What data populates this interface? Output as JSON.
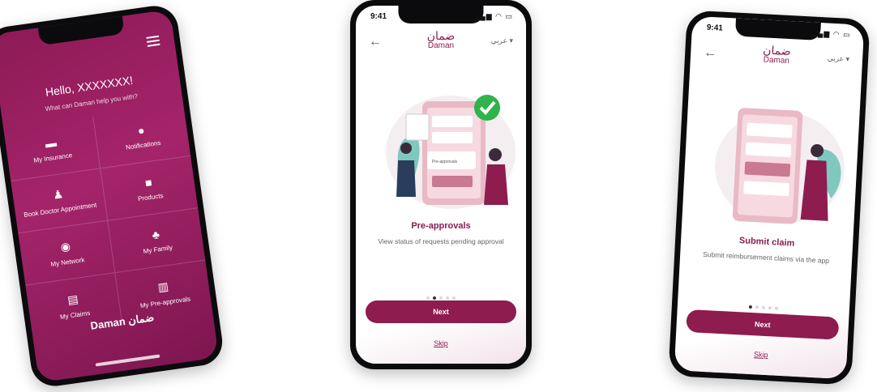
{
  "phone1": {
    "greeting": "Hello, XXXXXXX!",
    "subtitle": "What can Daman help you with?",
    "tiles": [
      {
        "label": "My Insurance",
        "icon": "insurance-card-icon"
      },
      {
        "label": "Notifications",
        "icon": "notification-bell-icon"
      },
      {
        "label": "Book Doctor Appointment",
        "icon": "doctor-icon"
      },
      {
        "label": "Products",
        "icon": "shopping-bag-icon"
      },
      {
        "label": "My Network",
        "icon": "network-globe-icon"
      },
      {
        "label": "My Family",
        "icon": "family-icon"
      },
      {
        "label": "My Claims",
        "icon": "document-icon"
      },
      {
        "label": "My Pre-approvals",
        "icon": "pre-approval-doc-icon"
      }
    ],
    "brand": "Daman ضمان",
    "accent": "#8e1a57"
  },
  "phone2": {
    "time": "9:41",
    "logo_ar": "ضمان",
    "logo_en": "Daman",
    "lang": "عربي ▾",
    "title": "Pre-approvals",
    "description": "View status of requests pending approval",
    "illustration_label": "Pre-approvals",
    "next": "Next",
    "skip": "Skip",
    "active_dot": 1
  },
  "phone3": {
    "time": "9:41",
    "logo_ar": "ضمان",
    "logo_en": "Daman",
    "lang": "عربي ▾",
    "title": "Submit claim",
    "description": "Submit reimbursement claims via the app",
    "next": "Next",
    "skip": "Skip",
    "active_dot": 0
  },
  "colors": {
    "primary": "#8e1c4f",
    "check": "#2fb34a",
    "teal": "#7fc8c0"
  }
}
